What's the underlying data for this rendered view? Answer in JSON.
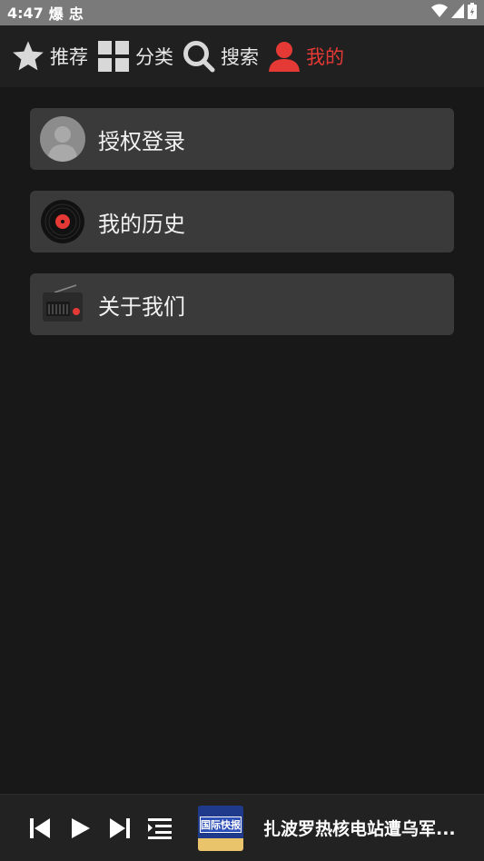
{
  "status_bar": {
    "time": "4:47",
    "notif1": "爆",
    "notif2": "忠"
  },
  "nav": {
    "tabs": [
      {
        "label": "推荐",
        "icon": "star-icon"
      },
      {
        "label": "分类",
        "icon": "grid-icon"
      },
      {
        "label": "搜索",
        "icon": "search-icon"
      },
      {
        "label": "我的",
        "icon": "user-icon",
        "active": true
      }
    ]
  },
  "menu": {
    "items": [
      {
        "label": "授权登录",
        "icon": "avatar-icon"
      },
      {
        "label": "我的历史",
        "icon": "vinyl-record-icon"
      },
      {
        "label": "关于我们",
        "icon": "radio-icon"
      }
    ]
  },
  "player": {
    "cover_text": "国际快报",
    "track_title": "扎波罗热核电站遭乌军..."
  },
  "colors": {
    "accent": "#e53935",
    "background": "#181818",
    "card": "#3a3a3a"
  }
}
